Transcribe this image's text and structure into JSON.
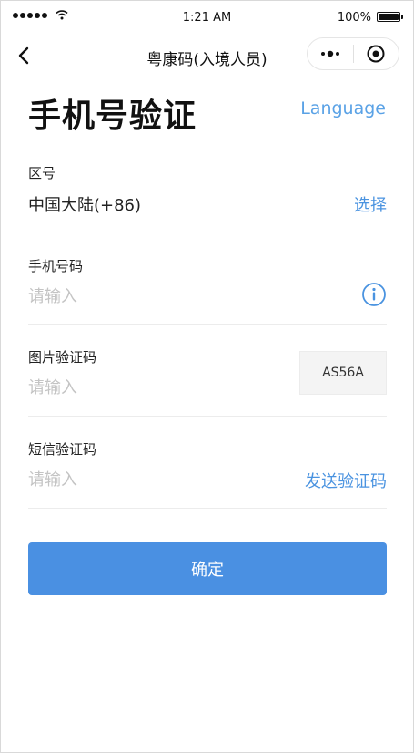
{
  "status_bar": {
    "time": "1:21 AM",
    "battery_percent": "100%",
    "battery_level": 1.0
  },
  "nav": {
    "title": "粤康码(入境人员)",
    "back_icon": "chevron-left-icon",
    "menu_icon": "more-dots-icon",
    "close_icon": "target-circle-icon"
  },
  "header": {
    "title": "手机号验证",
    "language_link": "Language"
  },
  "form": {
    "region": {
      "label": "区号",
      "value": "中国大陆(+86)",
      "action": "选择"
    },
    "phone": {
      "label": "手机号码",
      "placeholder": "请输入",
      "info_icon": "info-circle-icon"
    },
    "image_captcha": {
      "label": "图片验证码",
      "placeholder": "请输入",
      "captcha_text": "AS56A"
    },
    "sms_code": {
      "label": "短信验证码",
      "placeholder": "请输入",
      "action": "发送验证码"
    }
  },
  "confirm_label": "确定",
  "colors": {
    "accent": "#4a90e2",
    "link": "#4a93e0",
    "placeholder": "#c4c4c4"
  }
}
